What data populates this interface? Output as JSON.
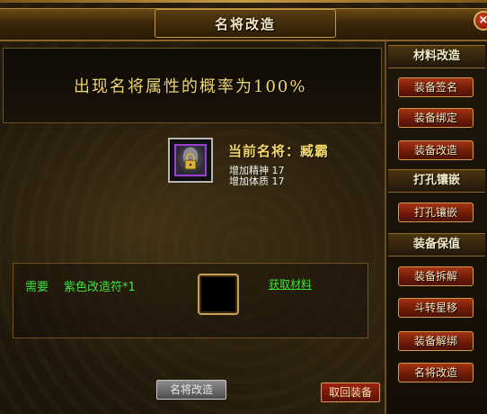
{
  "window": {
    "title": "名将改造",
    "close_symbol": "×"
  },
  "main": {
    "probability_text": "出现名将属性的概率为100%",
    "general": {
      "icon": "general-item-icon",
      "name_line": "当前名将：臧霸",
      "stats": [
        "增加精神 17",
        "增加体质 17"
      ]
    },
    "requirement": {
      "label": "需要",
      "item": "紫色改造符*1",
      "get_materials_link": "获取材料"
    },
    "reform_button": "名将改造",
    "retrieve_button": "取回装备"
  },
  "side": {
    "sections": [
      {
        "title": "材料改造",
        "buttons": [
          "装备签名",
          "装备绑定",
          "装备改造"
        ]
      },
      {
        "title": "打孔镶嵌",
        "buttons": [
          "打孔镶嵌"
        ]
      },
      {
        "title": "装备保值",
        "buttons": [
          "装备拆解",
          "斗转星移",
          "装备解绑",
          "名将改造"
        ]
      }
    ]
  },
  "colors": {
    "green_text": "#3fe040",
    "gold_text": "#f1d870",
    "button_red": "#8a2410"
  }
}
